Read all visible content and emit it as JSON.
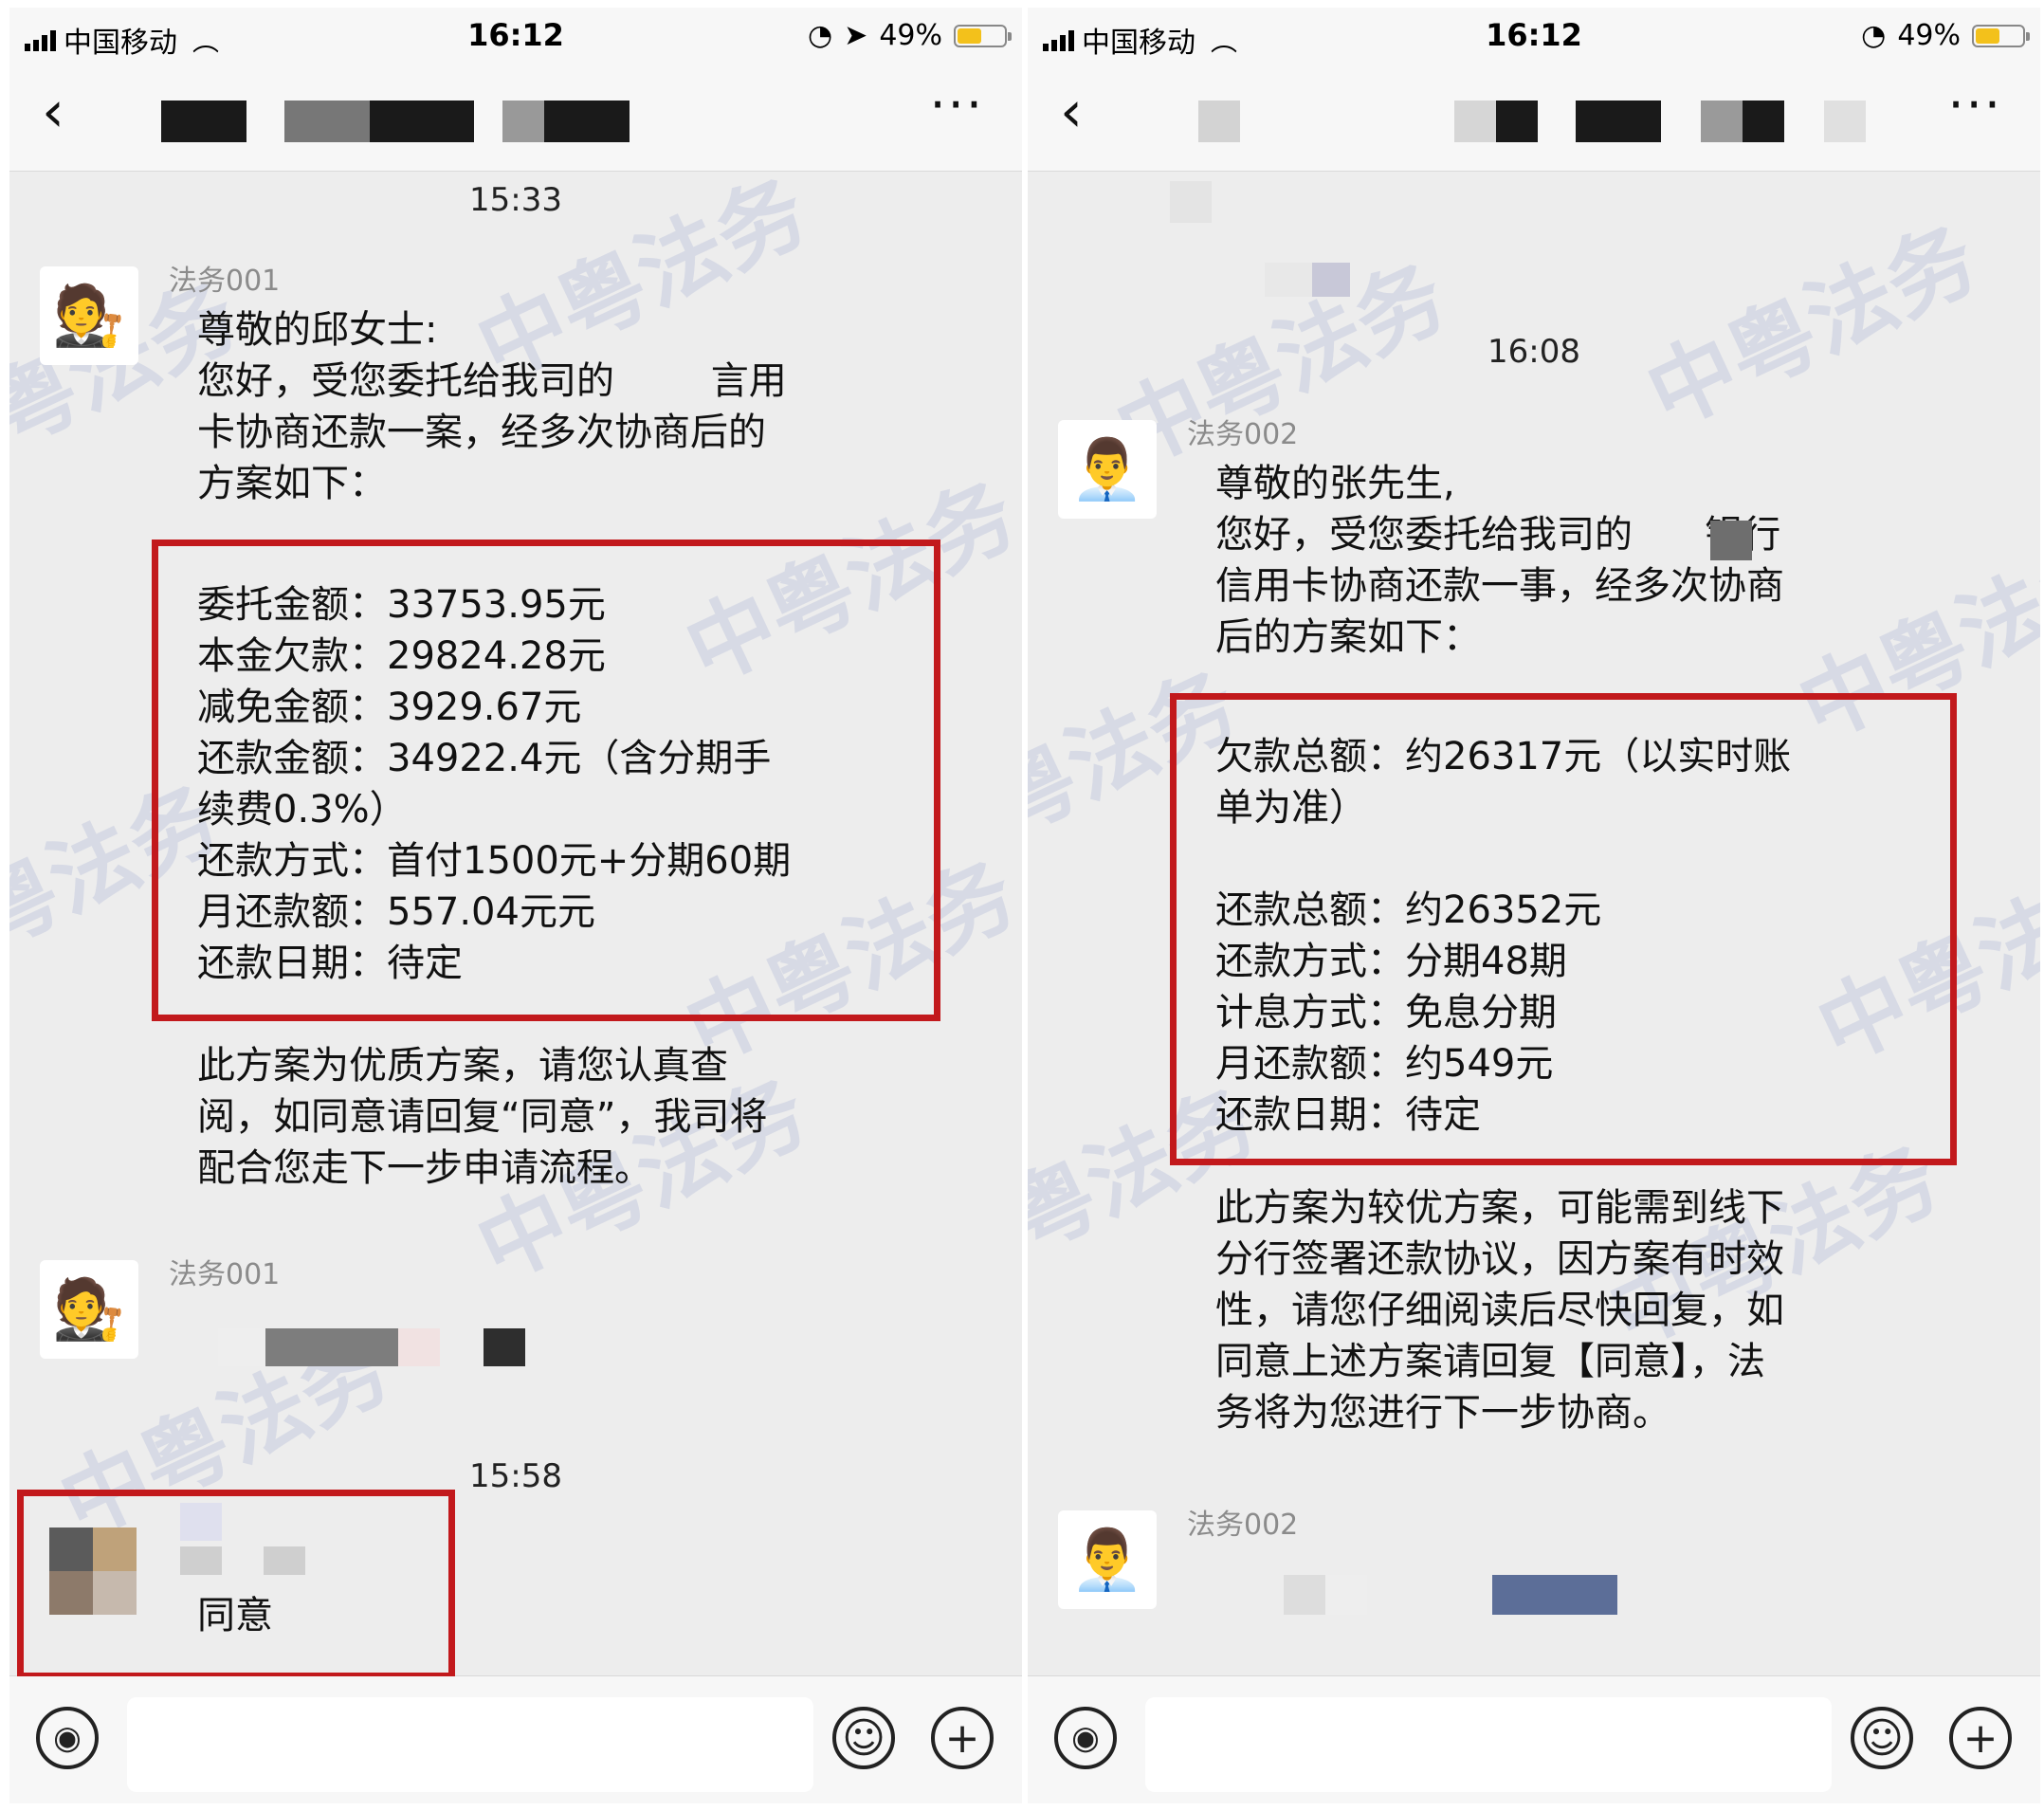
{
  "left": {
    "status": {
      "carrier": "中国移动",
      "time": "16:12",
      "battery": "49%",
      "battery_level": 0.49
    },
    "chat": {
      "ts1": "15:33",
      "sender1": "法务001",
      "greeting": "尊敬的邱女士:",
      "intro": "您好，受您委托给我司的        言用\n卡协商还款一案，经多次协商后的\n方案如下：",
      "plan": "委托金额：33753.95元\n本金欠款：29824.28元\n减免金额：3929.67元\n还款金额：34922.4元（含分期手\n续费0.3%）\n还款方式：首付1500元+分期60期\n月还款额：557.04元元\n还款日期：待定",
      "outro": "此方案为优质方案，请您认真查\n阅，如同意请回复“同意”，我司将\n配合您走下一步申请流程。",
      "sender2": "法务001",
      "ts2": "15:58",
      "reply": "同意",
      "watermark": "中粤法务"
    }
  },
  "right": {
    "status": {
      "carrier": "中国移动",
      "time": "16:12",
      "battery": "49%",
      "battery_level": 0.49
    },
    "chat": {
      "ts1": "16:08",
      "sender1": "法务002",
      "greeting": "尊敬的张先生,",
      "intro": "您好，受您委托给我司的      银行\n信用卡协商还款一事，经多次协商\n后的方案如下：",
      "plan": "欠款总额：约26317元（以实时账\n单为准）\n\n还款总额：约26352元\n还款方式：分期48期\n计息方式：免息分期\n月还款额：约549元\n还款日期：待定",
      "outro": "此方案为较优方案，可能需到线下\n分行签署还款协议，因方案有时效\n性，请您仔细阅读后尽快回复，如\n同意上述方案请回复【同意】，法\n务将为您进行下一步协商。",
      "sender2": "法务002",
      "watermark": "中粤法务"
    }
  },
  "icons": {
    "back": "‹",
    "more": "···",
    "voice": "◉",
    "emoji": "☺",
    "plus": "+",
    "avatar1": "🧑‍⚖️",
    "avatar2": "👨‍💼",
    "location": "➤",
    "lock": "◔"
  },
  "colors": {
    "highlight_red": "#c2191c",
    "bg": "#ededed",
    "bar": "#f7f7f7"
  }
}
